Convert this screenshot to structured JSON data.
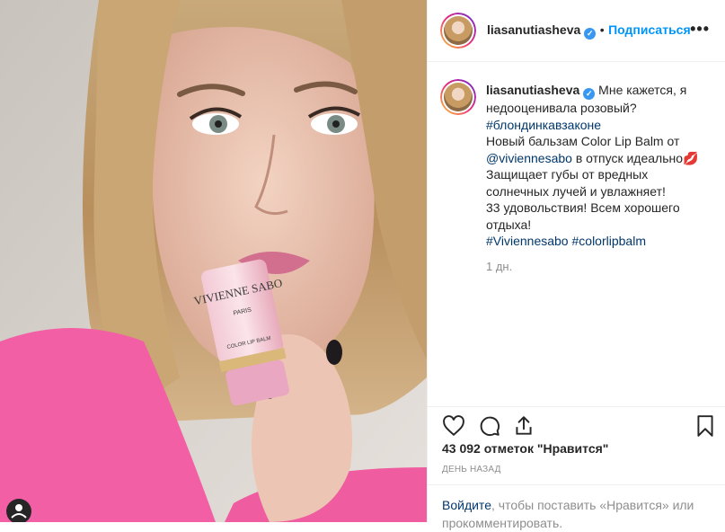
{
  "post": {
    "username": "liasanutiasheva",
    "verified_icon": "verified-badge-icon",
    "follow_label": "Подписаться",
    "separator": "•",
    "more_label": "•••"
  },
  "caption": {
    "username": "liasanutiasheva",
    "lines": [
      {
        "text": "Мне кажется, я",
        "link": false
      },
      {
        "text": "недооценивала розовый?",
        "link": false
      },
      {
        "text": "#блондинкавзаконе",
        "link": true
      },
      {
        "text": "Новый бальзам Color Lip Balm от",
        "link": false
      },
      {
        "mention": "@viviennesabo",
        "rest": " в отпуск идеально💋"
      },
      {
        "text": "Защищает губы от вредных",
        "link": false
      },
      {
        "text": "солнечных лучей и увлажняет!",
        "link": false
      },
      {
        "text": "33 удовольствия! Всем хорошего",
        "link": false
      },
      {
        "text": "отдыха!",
        "link": false
      },
      {
        "tags": [
          "#Viviennesabo",
          "#colorlipbalm"
        ]
      }
    ],
    "time": "1 дн."
  },
  "actions": {
    "icons": [
      "heart-icon",
      "comment-icon",
      "share-icon",
      "bookmark-icon"
    ]
  },
  "likes_text": "43 092 отметок \"Нравится\"",
  "ago_text": "ДЕНЬ НАЗАД",
  "login_prompt": {
    "link": "Войдите",
    "rest": ", чтобы поставить «Нравится» или прокомментировать."
  },
  "photo": {
    "lipstick_brand": "VIVIENNE SABO",
    "lipstick_sub": "PARIS",
    "lipstick_label": "COLOR LIP BALM"
  },
  "colors": {
    "accent": "#0095f6",
    "link": "#00376b",
    "muted": "#8e8e8e",
    "verified": "#3897f0"
  }
}
